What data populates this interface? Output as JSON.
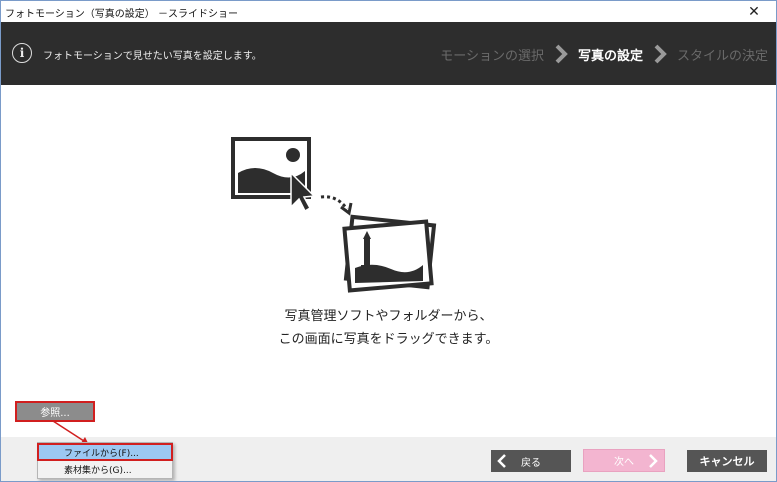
{
  "window": {
    "title": "フォトモーション（写真の設定） －スライドショー",
    "close_glyph": "✕"
  },
  "header": {
    "info_glyph": "i",
    "message": "フォトモーションで見せたい写真を設定します。",
    "steps": [
      {
        "label": "モーションの選択",
        "active": false
      },
      {
        "label": "写真の設定",
        "active": true
      },
      {
        "label": "スタイルの決定",
        "active": false
      }
    ],
    "arrow_icon": "chevron-right-icon"
  },
  "main": {
    "illustration_icon": "drag-photo-illustration",
    "hint_line1": "写真管理ソフトやフォルダーから、",
    "hint_line2": "この画面に写真をドラッグできます。"
  },
  "footer": {
    "browse_label": "参照...",
    "back_label": "戻る",
    "next_label": "次へ",
    "cancel_label": "キャンセル"
  },
  "dropdown": {
    "items": [
      {
        "label": "ファイルから(F)...",
        "highlighted": true
      },
      {
        "label": "素材集から(G)...",
        "highlighted": false
      }
    ]
  },
  "colors": {
    "header_bg": "#2d2d2d",
    "step_active": "#ffffff",
    "step_inactive": "#6a6a6a",
    "button_dark": "#555555",
    "next_disabled": "#f3b5d0",
    "annotation_red": "#d11f1f",
    "menu_highlight": "#9cc8f2"
  }
}
